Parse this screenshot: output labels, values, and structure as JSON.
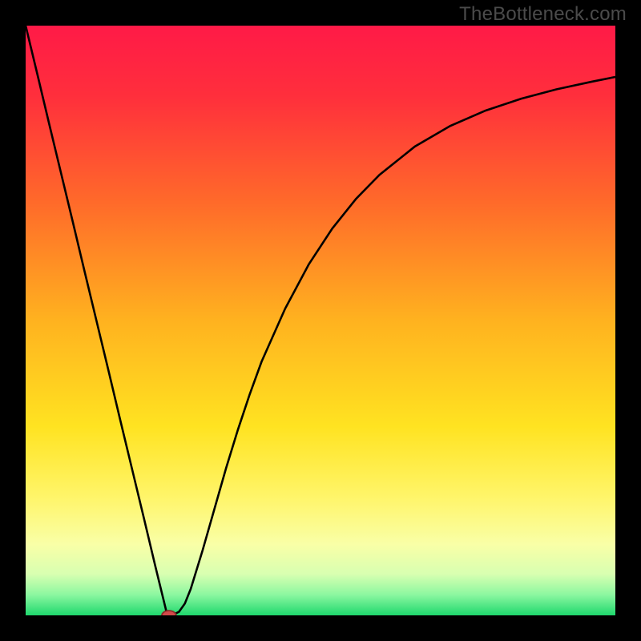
{
  "watermark": "TheBottleneck.com",
  "chart_data": {
    "type": "line",
    "title": "",
    "xlabel": "",
    "ylabel": "",
    "xlim": [
      0,
      100
    ],
    "ylim": [
      0,
      100
    ],
    "background_gradient": {
      "stops": [
        {
          "offset": 0.0,
          "color": "#ff1a47"
        },
        {
          "offset": 0.12,
          "color": "#ff2f3c"
        },
        {
          "offset": 0.3,
          "color": "#ff6a2a"
        },
        {
          "offset": 0.5,
          "color": "#ffb21f"
        },
        {
          "offset": 0.68,
          "color": "#ffe321"
        },
        {
          "offset": 0.8,
          "color": "#fff56a"
        },
        {
          "offset": 0.88,
          "color": "#f9ffa7"
        },
        {
          "offset": 0.93,
          "color": "#d8ffb1"
        },
        {
          "offset": 0.965,
          "color": "#8cf7a0"
        },
        {
          "offset": 1.0,
          "color": "#1fd86d"
        }
      ]
    },
    "series": [
      {
        "name": "bottleneck-curve",
        "stroke": "#000000",
        "stroke_width": 2.6,
        "x": [
          0.0,
          2.0,
          4.0,
          6.0,
          8.0,
          10.0,
          12.0,
          14.0,
          16.0,
          18.0,
          20.0,
          22.0,
          23.0,
          24.0,
          25.0,
          26.0,
          27.0,
          28.0,
          30.0,
          32.0,
          34.0,
          36.0,
          38.0,
          40.0,
          44.0,
          48.0,
          52.0,
          56.0,
          60.0,
          66.0,
          72.0,
          78.0,
          84.0,
          90.0,
          96.0,
          100.0
        ],
        "y": [
          100.0,
          91.7,
          83.3,
          75.0,
          66.7,
          58.3,
          50.0,
          41.7,
          33.3,
          25.0,
          16.7,
          8.3,
          4.2,
          0.1,
          0.1,
          0.6,
          2.0,
          4.5,
          11.0,
          18.0,
          25.0,
          31.5,
          37.5,
          43.0,
          52.0,
          59.5,
          65.6,
          70.6,
          74.7,
          79.5,
          83.0,
          85.6,
          87.6,
          89.2,
          90.5,
          91.3
        ]
      }
    ],
    "marker": {
      "name": "min-point",
      "x": 24.3,
      "y": 0.0,
      "rx": 1.2,
      "ry": 0.8,
      "fill": "#d24a4a",
      "stroke": "#8e2a2a"
    }
  }
}
